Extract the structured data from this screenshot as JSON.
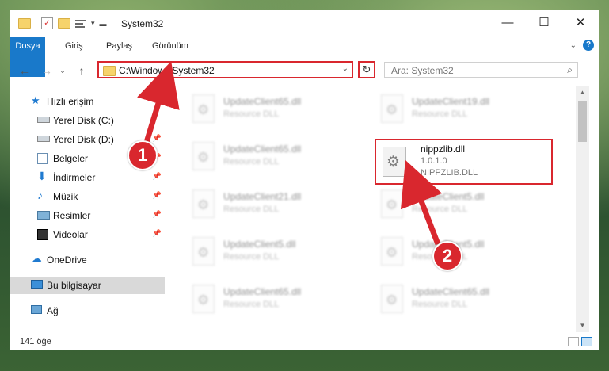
{
  "title": {
    "text": "System32"
  },
  "window_controls": {
    "minimize": "—",
    "maximize": "☐",
    "close": "✕"
  },
  "ribbon": {
    "tabs": [
      {
        "label": "Dosya"
      },
      {
        "label": "Giriş"
      },
      {
        "label": "Paylaş"
      },
      {
        "label": "Görünüm"
      }
    ],
    "help": "?"
  },
  "address": {
    "path": "C:\\Windows\\System32",
    "refresh": "↻"
  },
  "search": {
    "placeholder": "Ara: System32"
  },
  "sidebar": {
    "items": [
      {
        "label": "Hızlı erişim",
        "icon": "star-icon"
      },
      {
        "label": "Yerel Disk (C:)",
        "icon": "drive-icon"
      },
      {
        "label": "Yerel Disk (D:)",
        "icon": "drive-icon"
      },
      {
        "label": "Belgeler",
        "icon": "document-icon"
      },
      {
        "label": "İndirmeler",
        "icon": "download-icon"
      },
      {
        "label": "Müzik",
        "icon": "music-icon"
      },
      {
        "label": "Resimler",
        "icon": "picture-icon"
      },
      {
        "label": "Videolar",
        "icon": "video-icon"
      },
      {
        "label": "OneDrive",
        "icon": "cloud-icon"
      },
      {
        "label": "Bu bilgisayar",
        "icon": "computer-icon"
      },
      {
        "label": "Ağ",
        "icon": "network-icon"
      }
    ]
  },
  "files": {
    "left": [
      {
        "name": "UpdateClient65.dll",
        "type": "Resource DLL"
      },
      {
        "name": "UpdateClient65.dll",
        "type": "Resource DLL"
      },
      {
        "name": "UpdateClient21.dll",
        "type": "Resource DLL"
      },
      {
        "name": "UpdateClient5.dll",
        "type": "Resource DLL"
      },
      {
        "name": "UpdateClient65.dll",
        "type": "Resource DLL"
      }
    ],
    "right": [
      {
        "name": "UpdateClient19.dll",
        "type": "Resource DLL"
      },
      {
        "name": "UpdateClient5.dll",
        "type": "Resource DLL"
      },
      {
        "name": "UpdateClient5.dll",
        "type": "Resource DLL"
      },
      {
        "name": "UpdateClient65.dll",
        "type": "Resource DLL"
      }
    ],
    "highlighted": {
      "name": "nippzlib.dll",
      "version": "1.0.1.0",
      "description": "NIPPZLIB.DLL"
    }
  },
  "status": {
    "count": "141 öğe"
  },
  "annotations": {
    "step1": "1",
    "step2": "2",
    "color": "#d9272e"
  }
}
